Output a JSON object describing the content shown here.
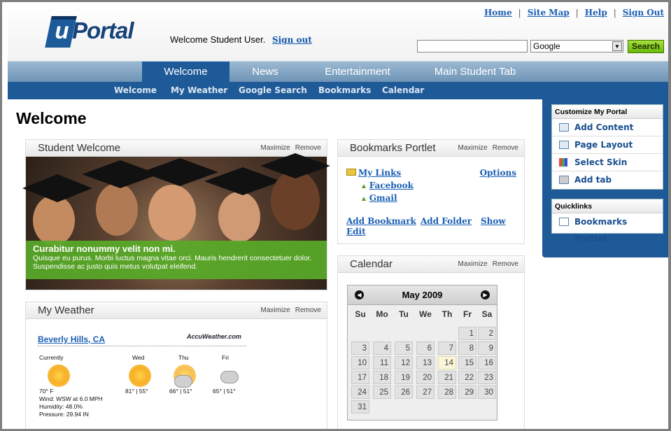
{
  "header": {
    "logo_text": "Portal",
    "logo_letter": "u",
    "welcome_text": "Welcome Student User.",
    "signout_label": "Sign out",
    "toplinks": [
      "Home",
      "Site Map",
      "Help",
      "Sign Out"
    ],
    "search_engine": "Google",
    "search_button": "Search"
  },
  "tabs": [
    {
      "label": "Welcome",
      "active": true
    },
    {
      "label": "News"
    },
    {
      "label": "Entertainment"
    },
    {
      "label": "Main Student Tab"
    }
  ],
  "subnav": [
    "Welcome",
    "My Weather",
    "Google Search",
    "Bookmarks",
    "Calendar"
  ],
  "page_title": "Welcome",
  "portlet_controls": {
    "maximize": "Maximize",
    "remove": "Remove"
  },
  "student_welcome": {
    "title": "Student Welcome",
    "caption_title": "Curabitur nonummy velit non mi.",
    "caption_text": "Quisque eu purus. Morbi luctus magna vitae orci. Mauris hendrerit consectetuer dolor. Suspendisse ac justo quis metus volutpat eleifend."
  },
  "bookmarks": {
    "title": "Bookmarks Portlet",
    "folder": "My Links",
    "options": "Options",
    "links": [
      "Facebook",
      "Gmail"
    ],
    "actions": [
      "Add Bookmark",
      "Add Folder",
      "Show"
    ],
    "edit": "Edit"
  },
  "weather": {
    "title": "My Weather",
    "location": "Beverly Hills, CA",
    "provider": "AccuWeather.com",
    "days": [
      {
        "label": "Currently",
        "icon": "sun-cloud-icon",
        "temp": "70° F"
      },
      {
        "label": "Wed",
        "icon": "sun-icon",
        "temp": "81° | 55°"
      },
      {
        "label": "Thu",
        "icon": "sun-cloud-icon",
        "temp": "66° | 51°"
      },
      {
        "label": "Fri",
        "icon": "cloud-icon",
        "temp": "65° | 51°"
      }
    ],
    "wind": "Wind: WSW at 6.0 MPH",
    "humidity": "Humidity: 48.0%",
    "pressure": "Pressure: 29.94 IN"
  },
  "calendar": {
    "title": "Calendar",
    "month": "May 2009",
    "dow": [
      "Su",
      "Mo",
      "Tu",
      "We",
      "Th",
      "Fr",
      "Sa"
    ],
    "first_weekday": 5,
    "days_in_month": 31,
    "today": 14
  },
  "customize": {
    "title": "Customize My Portal",
    "items": [
      "Add Content",
      "Page Layout",
      "Select Skin",
      "Add tab"
    ]
  },
  "quicklinks": {
    "title": "Quicklinks",
    "items": [
      "Bookmarks Portlet"
    ]
  }
}
